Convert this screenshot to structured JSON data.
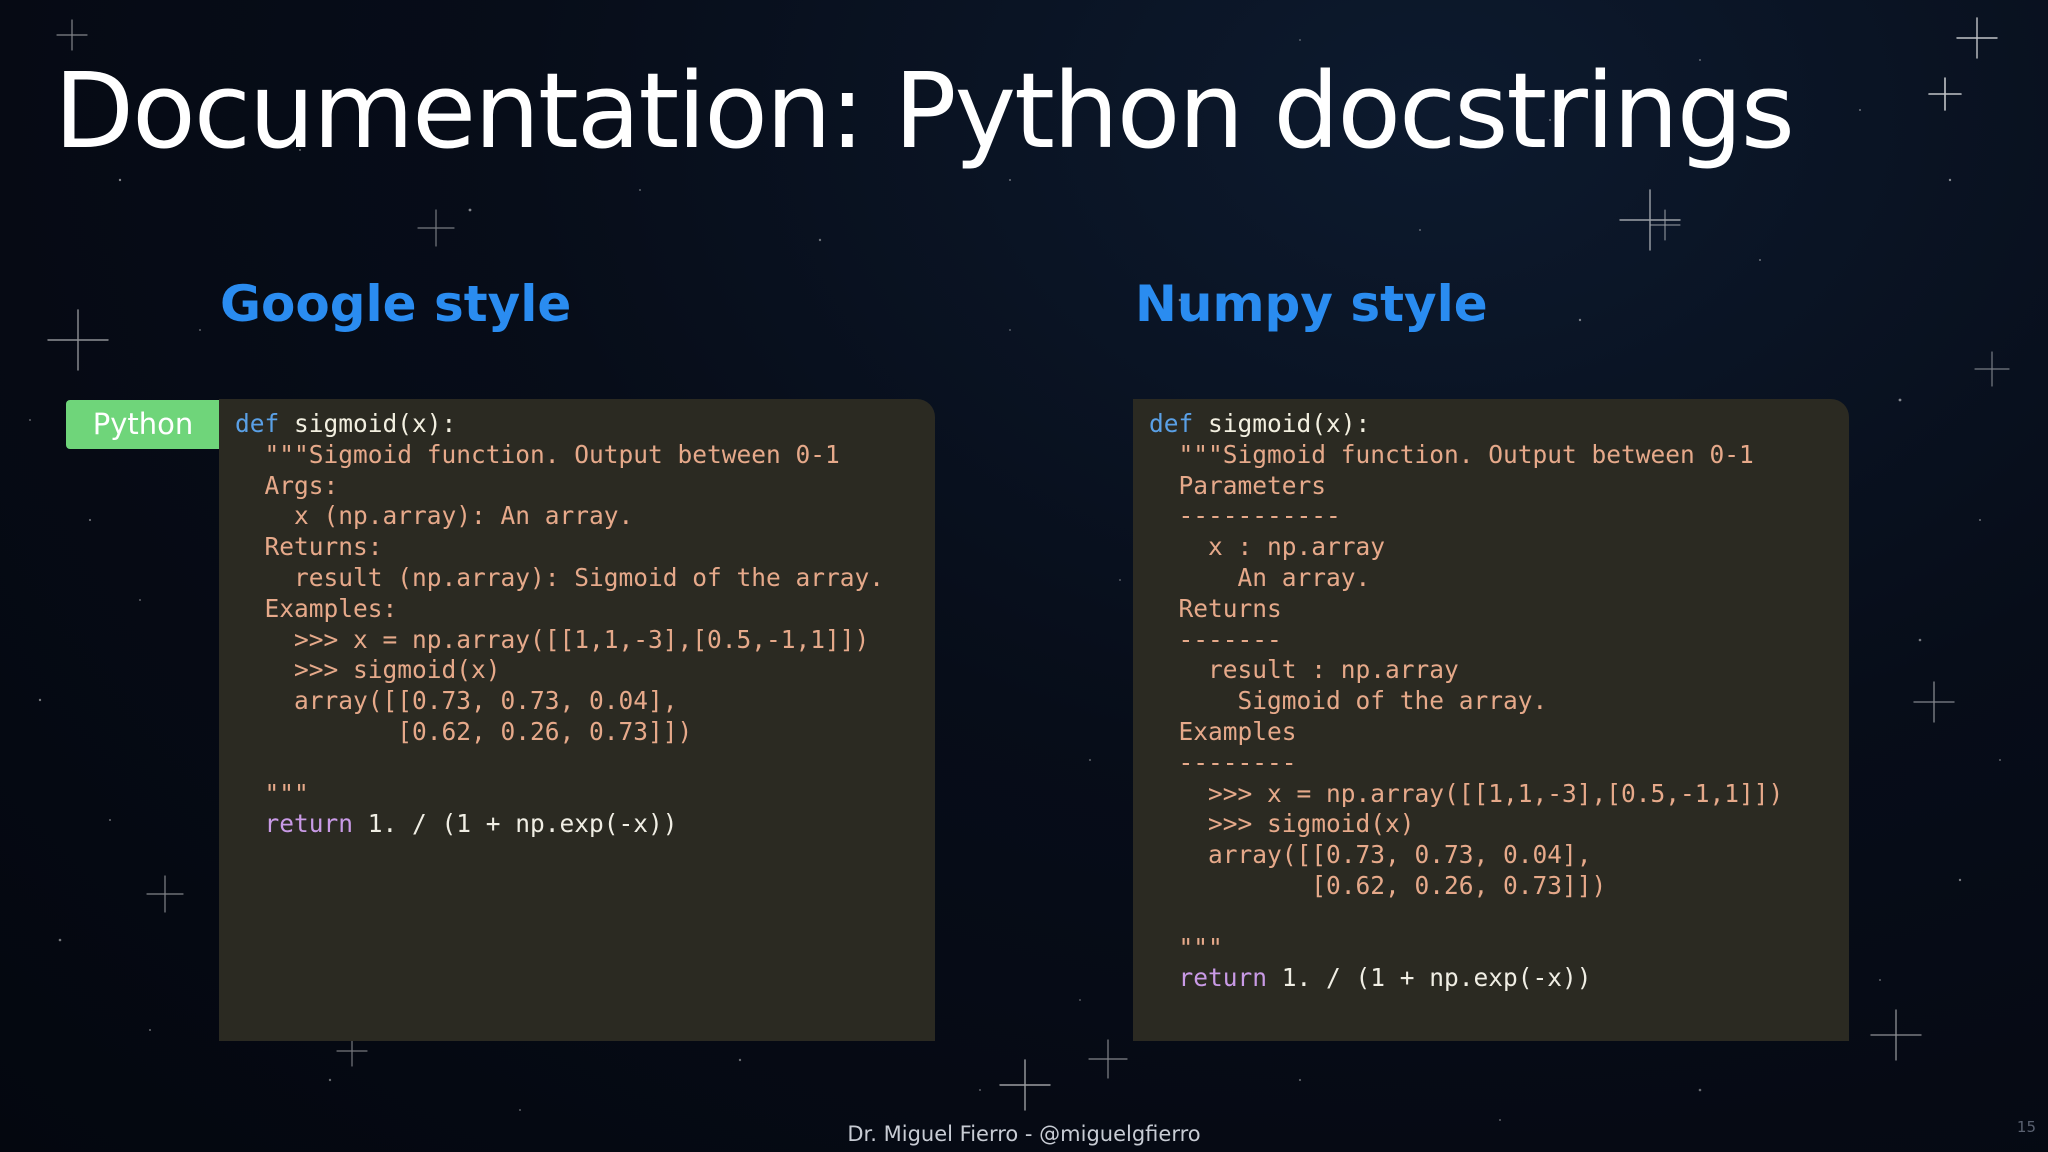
{
  "slide": {
    "title": "Documentation: Python docstrings",
    "footer": "Dr. Miguel Fierro - @miguelgfierro",
    "page_number": "15"
  },
  "sections": {
    "left": {
      "heading": "Google style",
      "tab_label": "Python"
    },
    "right": {
      "heading": "Numpy style"
    }
  },
  "colors": {
    "heading": "#2a8cf0",
    "panel_bg": "#2b2a22",
    "tab_bg": "#6fd57a",
    "keyword": "#5aa0e6",
    "docstring": "#e6a98a",
    "return_keyword": "#c99ae6"
  },
  "code": {
    "google": [
      [
        [
          "kw",
          "def"
        ],
        [
          "fn",
          " sigmoid(x):"
        ]
      ],
      [
        [
          "doc",
          "  \"\"\"Sigmoid function. Output between 0-1"
        ]
      ],
      [
        [
          "doc",
          "  Args:"
        ]
      ],
      [
        [
          "doc",
          "    x (np.array): An array."
        ]
      ],
      [
        [
          "doc",
          "  Returns:"
        ]
      ],
      [
        [
          "doc",
          "    result (np.array): Sigmoid of the array."
        ]
      ],
      [
        [
          "doc",
          "  Examples:"
        ]
      ],
      [
        [
          "doc",
          "    >>> x = np.array([[1,1,-3],[0.5,-1,1]])"
        ]
      ],
      [
        [
          "doc",
          "    >>> sigmoid(x)"
        ]
      ],
      [
        [
          "doc",
          "    array([[0.73, 0.73, 0.04],"
        ]
      ],
      [
        [
          "doc",
          "           [0.62, 0.26, 0.73]])"
        ]
      ],
      [
        [
          "doc",
          ""
        ]
      ],
      [
        [
          "doc",
          "  \"\"\""
        ]
      ],
      [
        [
          "ret",
          "  return"
        ],
        [
          "plain",
          " 1. / (1 + np.exp(-x))"
        ]
      ]
    ],
    "numpy": [
      [
        [
          "kw",
          "def"
        ],
        [
          "fn",
          " sigmoid(x):"
        ]
      ],
      [
        [
          "doc",
          "  \"\"\"Sigmoid function. Output between 0-1"
        ]
      ],
      [
        [
          "doc",
          "  Parameters"
        ]
      ],
      [
        [
          "doc",
          "  -----------"
        ]
      ],
      [
        [
          "doc",
          "    x : np.array"
        ]
      ],
      [
        [
          "doc",
          "      An array."
        ]
      ],
      [
        [
          "doc",
          "  Returns"
        ]
      ],
      [
        [
          "doc",
          "  -------"
        ]
      ],
      [
        [
          "doc",
          "    result : np.array"
        ]
      ],
      [
        [
          "doc",
          "      Sigmoid of the array."
        ]
      ],
      [
        [
          "doc",
          "  Examples"
        ]
      ],
      [
        [
          "doc",
          "  --------"
        ]
      ],
      [
        [
          "doc",
          "    >>> x = np.array([[1,1,-3],[0.5,-1,1]])"
        ]
      ],
      [
        [
          "doc",
          "    >>> sigmoid(x)"
        ]
      ],
      [
        [
          "doc",
          "    array([[0.73, 0.73, 0.04],"
        ]
      ],
      [
        [
          "doc",
          "           [0.62, 0.26, 0.73]])"
        ]
      ],
      [
        [
          "doc",
          ""
        ]
      ],
      [
        [
          "doc",
          "  \"\"\""
        ]
      ],
      [
        [
          "ret",
          "  return"
        ],
        [
          "plain",
          " 1. / (1 + np.exp(-x))"
        ]
      ]
    ]
  }
}
